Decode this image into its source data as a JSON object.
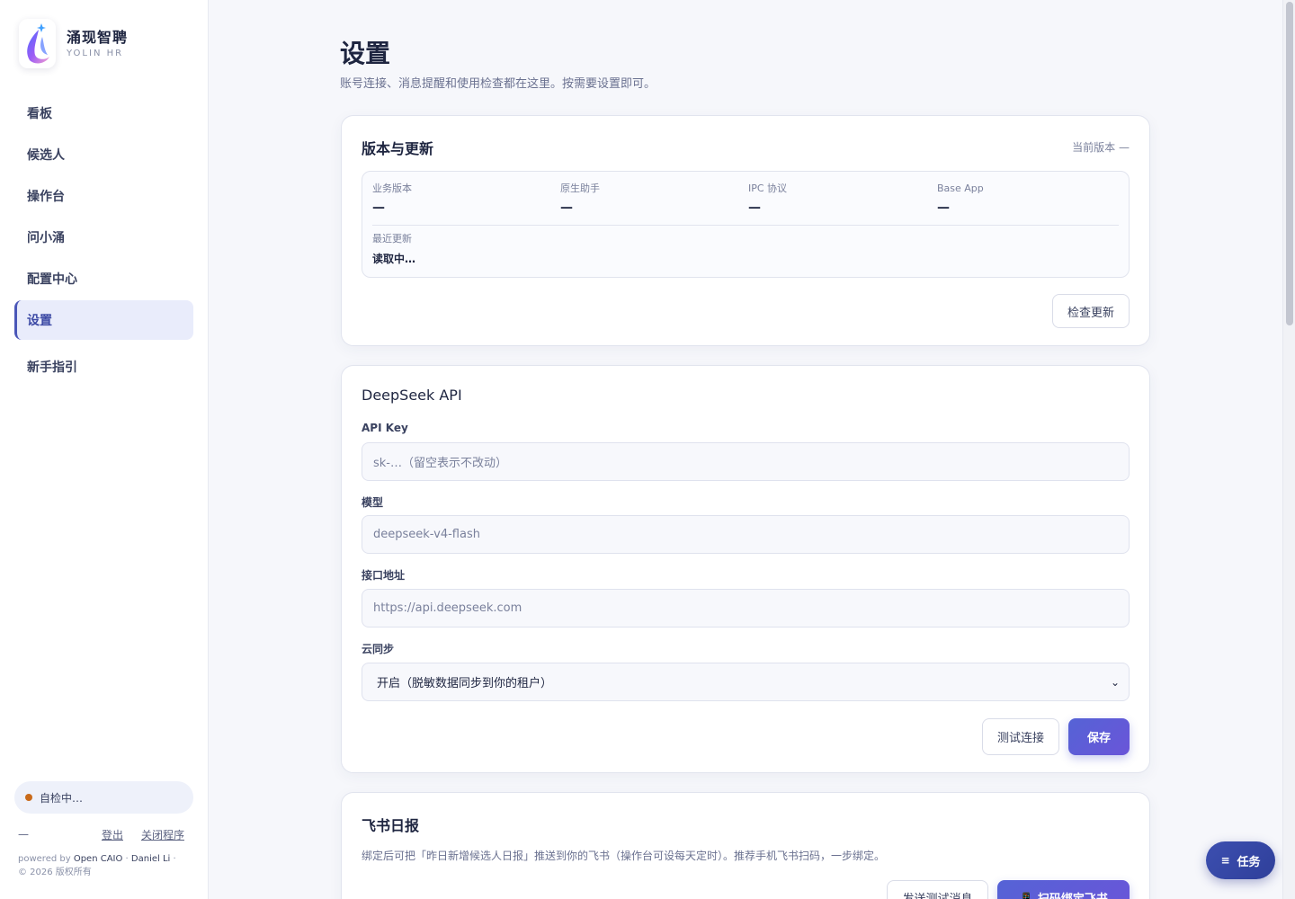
{
  "brand": {
    "name": "涌现智聘",
    "subtitle": "YOLIN HR"
  },
  "sidebar": {
    "items": [
      {
        "label": "看板"
      },
      {
        "label": "候选人"
      },
      {
        "label": "操作台"
      },
      {
        "label": "问小涌"
      },
      {
        "label": "配置中心"
      },
      {
        "label": "设置",
        "active": true
      },
      {
        "label": "新手指引"
      }
    ],
    "self_check": "自检中…",
    "footer_dash": "—",
    "logout": "登出",
    "close_app": "关闭程序",
    "powered_prefix": "powered by",
    "powered_org": "Open CAIO",
    "powered_sep": "·",
    "powered_author": "Daniel Li",
    "powered_sep2": "·",
    "copyright": "© 2026 版权所有"
  },
  "page": {
    "title": "设置",
    "description": "账号连接、消息提醒和使用检查都在这里。按需要设置即可。"
  },
  "version_card": {
    "title": "版本与更新",
    "current_version": "当前版本 —",
    "items": [
      {
        "label": "业务版本",
        "value": "—"
      },
      {
        "label": "原生助手",
        "value": "—"
      },
      {
        "label": "IPC 协议",
        "value": "—"
      },
      {
        "label": "Base App",
        "value": "—"
      }
    ],
    "recent_label": "最近更新",
    "recent_value": "读取中…",
    "check_button": "检查更新"
  },
  "deepseek_card": {
    "title": "DeepSeek API",
    "api_key_label": "API Key",
    "api_key_placeholder": "sk-…（留空表示不改动）",
    "model_label": "模型",
    "model_placeholder": "deepseek-v4-flash",
    "endpoint_label": "接口地址",
    "endpoint_placeholder": "https://api.deepseek.com",
    "sync_label": "云同步",
    "sync_value": "开启（脱敏数据同步到你的租户）",
    "test_button": "测试连接",
    "save_button": "保存"
  },
  "feishu_card": {
    "title": "飞书日报",
    "description": "绑定后可把「昨日新增候选人日报」推送到你的飞书（操作台可设每天定时）。推荐手机飞书扫码，一步绑定。",
    "send_test_button": "发送测试消息",
    "bind_button": "📱 扫码绑定飞书"
  },
  "task_button": {
    "icon": "≡",
    "label": "任务"
  },
  "colors": {
    "accent": "#4a56b8",
    "primary_button": "#5563d6",
    "status_dot": "#c96a1a"
  }
}
